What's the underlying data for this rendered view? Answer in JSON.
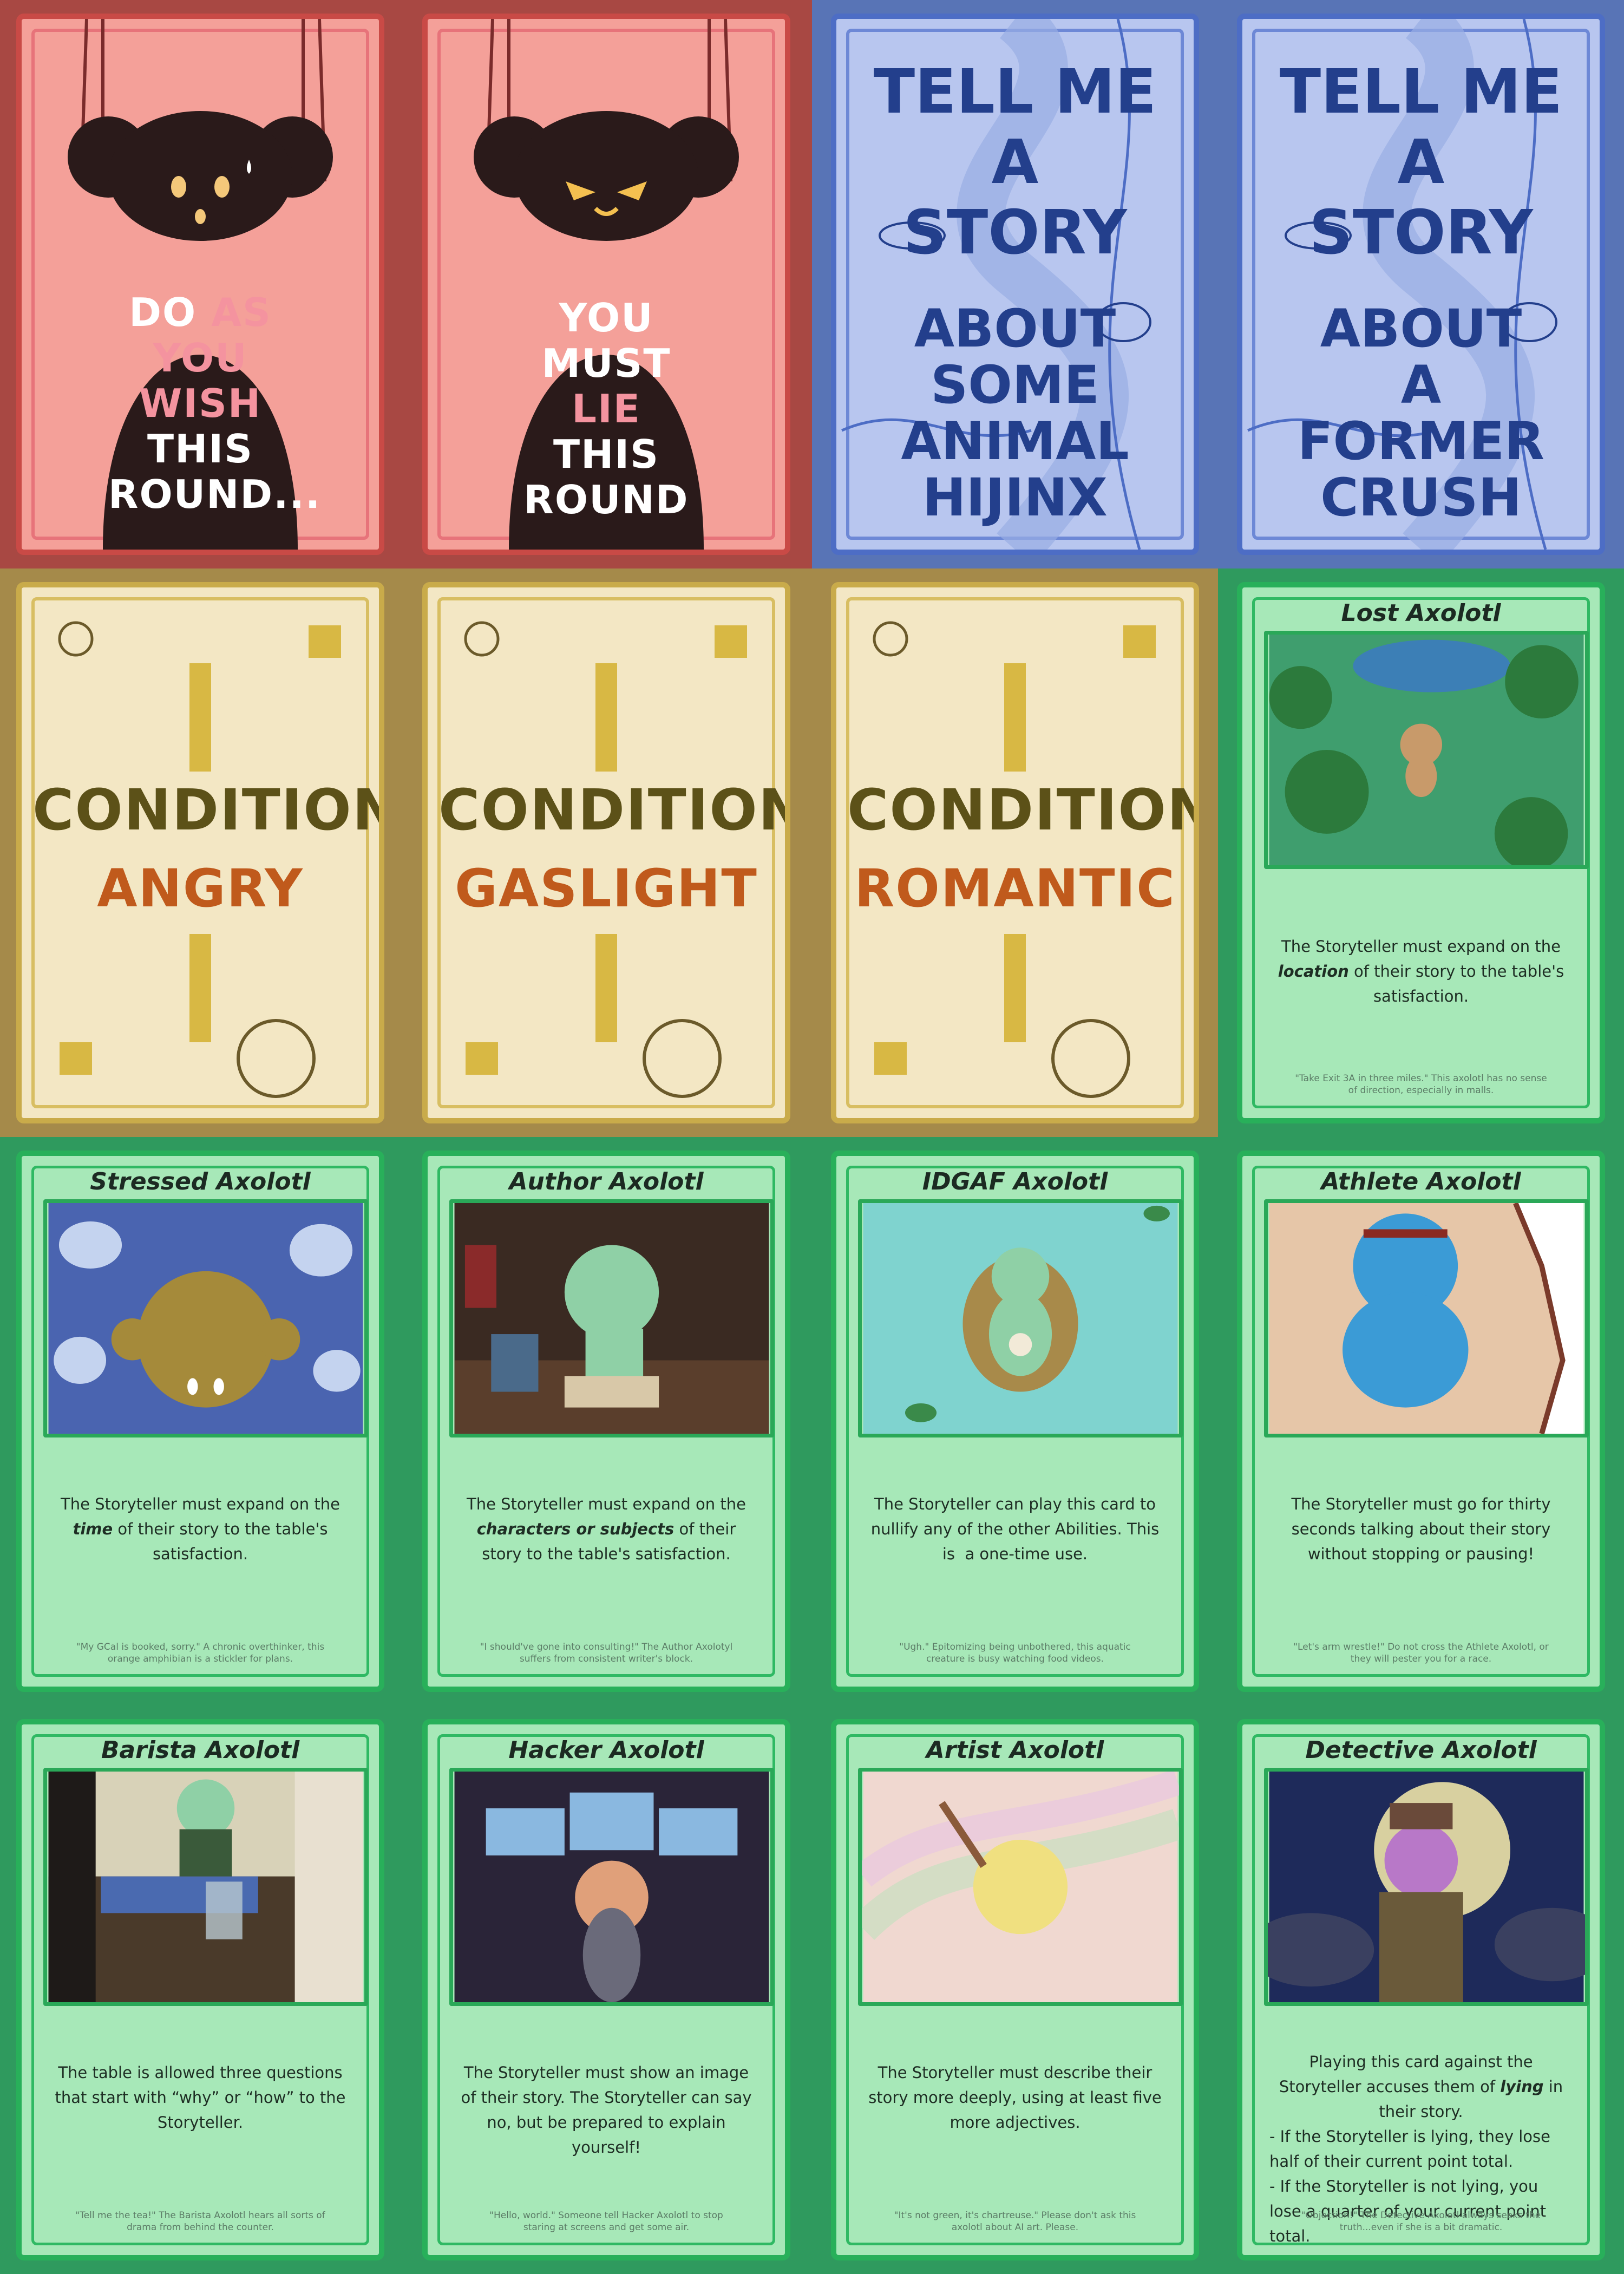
{
  "secret_cards": [
    {
      "lines": [
        [
          {
            "t": "DO ",
            "pink": false
          },
          {
            "t": "AS",
            "pink": true
          }
        ],
        [
          {
            "t": "YOU",
            "pink": true
          }
        ],
        [
          {
            "t": "WISH",
            "pink": true
          }
        ],
        [
          {
            "t": "THIS",
            "pink": false
          }
        ],
        [
          {
            "t": "ROUND...",
            "pink": false
          }
        ]
      ]
    },
    {
      "lines": [
        [
          {
            "t": "YOU",
            "pink": false
          }
        ],
        [
          {
            "t": "MUST",
            "pink": false
          }
        ],
        [
          {
            "t": "LIE ",
            "pink": true
          },
          {
            "t": "THIS",
            "pink": false
          }
        ],
        [
          {
            "t": "ROUND",
            "pink": false
          }
        ]
      ]
    }
  ],
  "story_cards": [
    {
      "top_lines": [
        "TELL ME A",
        "STORY"
      ],
      "bottom_lines": [
        "ABOUT",
        "SOME",
        "ANIMAL",
        "HIJINX"
      ]
    },
    {
      "top_lines": [
        "TELL ME A",
        "STORY"
      ],
      "bottom_lines": [
        "ABOUT",
        "A",
        "FORMER",
        "CRUSH"
      ]
    }
  ],
  "condition_cards": [
    {
      "label": "CONDITION",
      "value": "ANGRY"
    },
    {
      "label": "CONDITION",
      "value": "GASLIGHT"
    },
    {
      "label": "CONDITION",
      "value": "ROMANTIC"
    }
  ],
  "ability_cards": [
    {
      "title": "Lost Axolotl",
      "desc_html": "The Storyteller must expand on the <em>location</em> of their story to the table's satisfaction.",
      "flavor": "\"Take Exit 3A in three miles.\" This axolotl has no sense of direction, especially in malls.",
      "art": "forest"
    },
    {
      "title": "Stressed Axolotl",
      "desc_html": "The Storyteller must expand on the <em>time</em> of their story to the table's satisfaction.",
      "flavor": "\"My GCal is booked, sorry.\" A chronic overthinker, this orange amphibian is a stickler for plans.",
      "art": "stressed"
    },
    {
      "title": "Author Axolotl",
      "desc_html": "The Storyteller must expand on the <em>characters or subjects</em> of their story to the table's satisfaction.",
      "flavor": "\"I should've gone into consulting!\" The Author Axolotyl suffers from consistent writer's block.",
      "art": "author"
    },
    {
      "title": "IDGAF Axolotl",
      "desc_html": "The Storyteller can play this card to nullify any of the other Abilities. This is&nbsp; a one-time use.",
      "flavor": "\"Ugh.\" Epitomizing being unbothered, this aquatic creature is busy watching food videos.",
      "art": "idgaf"
    },
    {
      "title": "Athlete Axolotl",
      "desc_html": "The Storyteller must go for thirty seconds talking about their story without stopping or pausing!",
      "flavor": "\"Let's arm wrestle!\" Do not cross the Athlete Axolotl, or they will pester you for a race.",
      "art": "athlete"
    },
    {
      "title": "Barista Axolotl",
      "desc_html": "The table is allowed three questions that start with “why” or “how” to the Storyteller.",
      "flavor": "\"Tell me the tea!\" The Barista Axolotl hears all sorts of drama from behind the counter.",
      "art": "barista"
    },
    {
      "title": "Hacker Axolotl",
      "desc_html": "The Storyteller must show an image of their story. The Storyteller can say no, but be prepared to explain yourself!",
      "flavor": "\"Hello, world.\" Someone tell Hacker Axolotl to stop staring at screens and get some air.",
      "art": "hacker"
    },
    {
      "title": "Artist Axolotl",
      "desc_html": "The Storyteller must describe their story more deeply, using at least five more adjectives.",
      "flavor": "\"It's not green, it's chartreuse.\" Please don't ask this axolotl about AI art. Please.",
      "art": "artist"
    },
    {
      "title": "Detective Axolotl",
      "desc_html": "<span class='c'>Playing this card against the Storyteller accuses them of <em>lying</em> in their story.</span>- If the Storyteller is lying, they lose half of their current point total.<br>- If the Storyteller is not lying, you lose a quarter of your current point total.",
      "flavor": "\"Objection!\" The Detective Axolotl always seeks the truth...even if she is a bit dramatic.",
      "art": "detective"
    }
  ],
  "colors": {
    "secret_bg": "#a84843",
    "story_bg": "#5874b6",
    "condition_bg": "#a58a4a",
    "ability_bg": "#2f9a5e"
  }
}
